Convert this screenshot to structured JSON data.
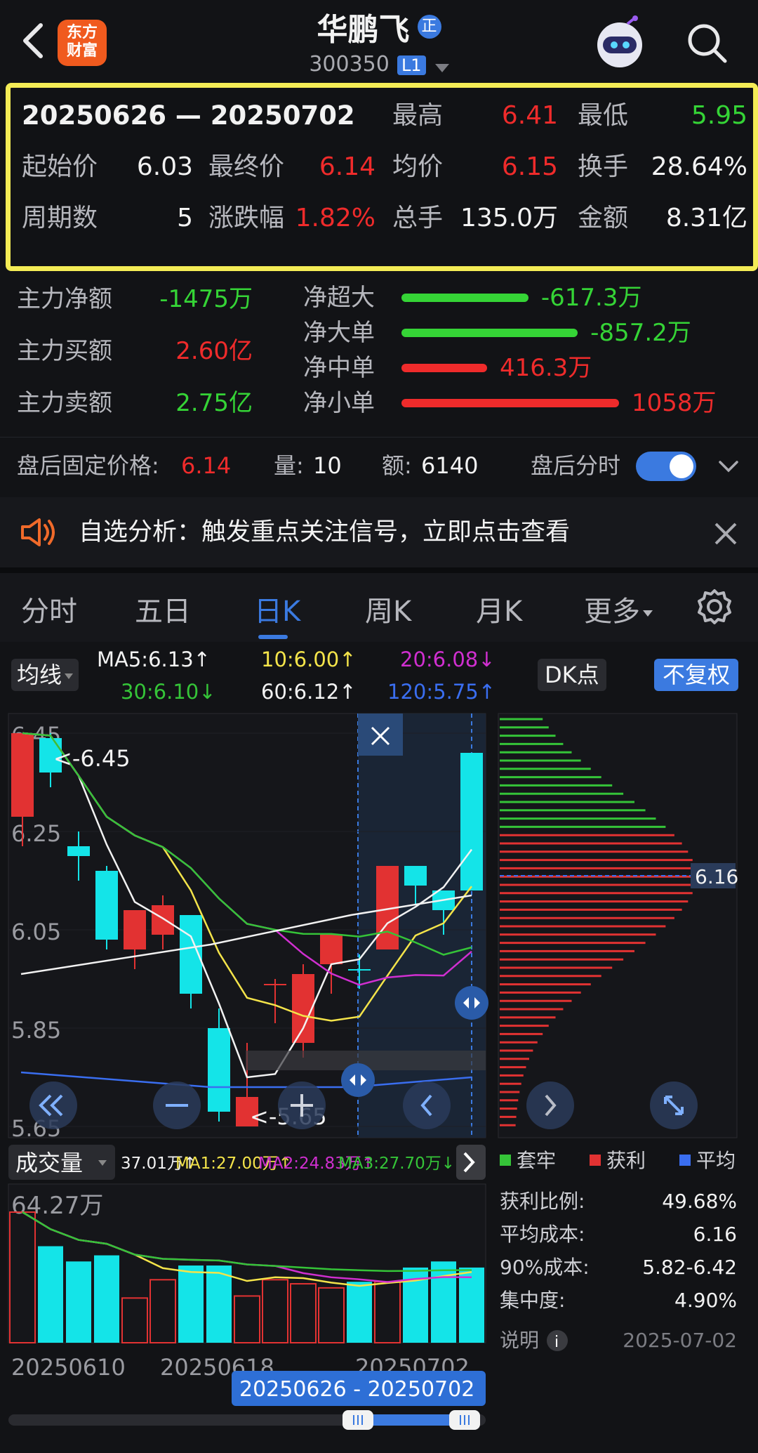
{
  "header": {
    "title": "华鹏飞",
    "badge": "正",
    "code": "300350",
    "level": "L1",
    "logo_line1": "东方",
    "logo_line2": "财富"
  },
  "summary": {
    "range": "20250626 — 20250702",
    "high_label": "最高",
    "high": "6.41",
    "low_label": "最低",
    "low": "5.95",
    "open_label": "起始价",
    "open": "6.03",
    "close_label": "最终价",
    "close": "6.14",
    "avg_label": "均价",
    "avg": "6.15",
    "turnover_label": "换手",
    "turnover": "28.64%",
    "periods_label": "周期数",
    "periods": "5",
    "change_label": "涨跌幅",
    "change": "1.82%",
    "volume_label": "总手",
    "volume": "135.0万",
    "amount_label": "金额",
    "amount": "8.31亿"
  },
  "flow": {
    "net_label": "主力净额",
    "net": "-1475万",
    "buy_label": "主力买额",
    "buy": "2.60亿",
    "sell_label": "主力卖额",
    "sell": "2.75亿",
    "bars": [
      {
        "label": "净超大",
        "value": "-617.3万",
        "amount": -617.3,
        "color": "#35d436"
      },
      {
        "label": "净大单",
        "value": "-857.2万",
        "amount": -857.2,
        "color": "#35d436"
      },
      {
        "label": "净中单",
        "value": "416.3万",
        "amount": 416.3,
        "color": "#ef2b2b"
      },
      {
        "label": "净小单",
        "value": "1058万",
        "amount": 1058,
        "color": "#ef2b2b"
      }
    ]
  },
  "post": {
    "price_label": "盘后固定价格:",
    "price": "6.14",
    "vol_label": "量:",
    "vol": "10",
    "amt_label": "额:",
    "amt": "6140",
    "toggle_label": "盘后分时",
    "toggle_on": true
  },
  "notice": {
    "text": "自选分析：触发重点关注信号，立即点击查看"
  },
  "tabs": {
    "items": [
      "分时",
      "五日",
      "日K",
      "周K",
      "月K",
      "更多"
    ],
    "active": 2
  },
  "indicators": {
    "ma_selector": "均线",
    "ma5": "MA5:6.13↑",
    "ma10": "10:6.00↑",
    "ma20": "20:6.08↓",
    "ma30": "30:6.10↓",
    "ma60": "60:6.12↑",
    "ma120": "120:5.75↑",
    "dk": "DK点",
    "fq": "不复权",
    "ma_colors": {
      "ma5": "#f2f2f2",
      "ma10": "#f4e44a",
      "ma20": "#d02fd0",
      "ma30": "#35c438",
      "ma60": "#f2f2f2",
      "ma120": "#3a6ef0"
    }
  },
  "chart_data": {
    "type": "candlestick",
    "price_ticks": [
      "6.45",
      "6.25",
      "6.05",
      "5.85",
      "5.65"
    ],
    "ylim": [
      5.65,
      6.45
    ],
    "high_marker": "<-6.45",
    "low_marker": "<-5.65",
    "candles": [
      {
        "o": 6.28,
        "c": 6.45,
        "h": 6.45,
        "l": 6.22,
        "up": true
      },
      {
        "o": 6.37,
        "c": 6.44,
        "h": 6.45,
        "l": 6.34,
        "up": false
      },
      {
        "o": 6.22,
        "c": 6.2,
        "h": 6.25,
        "l": 6.15,
        "up": false
      },
      {
        "o": 6.17,
        "c": 6.03,
        "h": 6.18,
        "l": 6.01,
        "up": false
      },
      {
        "o": 6.01,
        "c": 6.09,
        "h": 6.09,
        "l": 5.97,
        "up": true
      },
      {
        "o": 6.04,
        "c": 6.1,
        "h": 6.12,
        "l": 6.01,
        "up": true
      },
      {
        "o": 6.08,
        "c": 5.92,
        "h": 6.08,
        "l": 5.89,
        "up": false
      },
      {
        "o": 5.85,
        "c": 5.68,
        "h": 5.89,
        "l": 5.66,
        "up": false
      },
      {
        "o": 5.71,
        "c": 5.65,
        "h": 5.82,
        "l": 5.65,
        "up": true
      },
      {
        "o": 5.94,
        "c": 5.94,
        "h": 5.95,
        "l": 5.86,
        "up": true
      },
      {
        "o": 5.82,
        "c": 5.96,
        "h": 5.98,
        "l": 5.79,
        "up": true
      },
      {
        "o": 5.98,
        "c": 6.04,
        "h": 6.04,
        "l": 5.92,
        "up": true
      },
      {
        "o": 5.97,
        "c": 5.97,
        "h": 6.0,
        "l": 5.93,
        "up": false
      },
      {
        "o": 6.01,
        "c": 6.18,
        "h": 6.18,
        "l": 6.01,
        "up": true
      },
      {
        "o": 6.18,
        "c": 6.14,
        "h": 6.18,
        "l": 6.1,
        "up": false
      },
      {
        "o": 6.13,
        "c": 6.09,
        "h": 6.13,
        "l": 6.04,
        "up": false
      },
      {
        "o": 6.13,
        "c": 6.41,
        "h": 6.41,
        "l": 6.13,
        "up": false
      }
    ],
    "selection_label": "20250626 - 20250702",
    "cost_price_label": "6.16",
    "volume_title": "成交量",
    "volume_stats": {
      "cur": "37.01万↑",
      "ma1": "MA1:27.00万↑",
      "ma2": "MA2:24.83万↑",
      "ma3": "MA3:27.70万↓"
    },
    "volume_max": "64.27万",
    "volumes": [
      64.27,
      47.5,
      40.0,
      43.0,
      22.0,
      31.0,
      38.0,
      38.0,
      23.0,
      31.0,
      29.0,
      27.0,
      30.0,
      30.0,
      37.0,
      40.0,
      37.0
    ],
    "date_labels": [
      "20250610",
      "20250618",
      "20250702"
    ]
  },
  "chips": {
    "legend": [
      {
        "label": "套牢",
        "color": "#35c438"
      },
      {
        "label": "获利",
        "color": "#e23232"
      },
      {
        "label": "平均",
        "color": "#3a6ef0"
      }
    ],
    "rows": [
      {
        "label": "获利比例:",
        "value": "49.68%"
      },
      {
        "label": "平均成本:",
        "value": "6.16"
      },
      {
        "label": "90%成本:",
        "value": "5.82-6.42"
      },
      {
        "label": "集中度:",
        "value": "4.90%"
      }
    ],
    "note_label": "说明",
    "date": "2025-07-02"
  }
}
